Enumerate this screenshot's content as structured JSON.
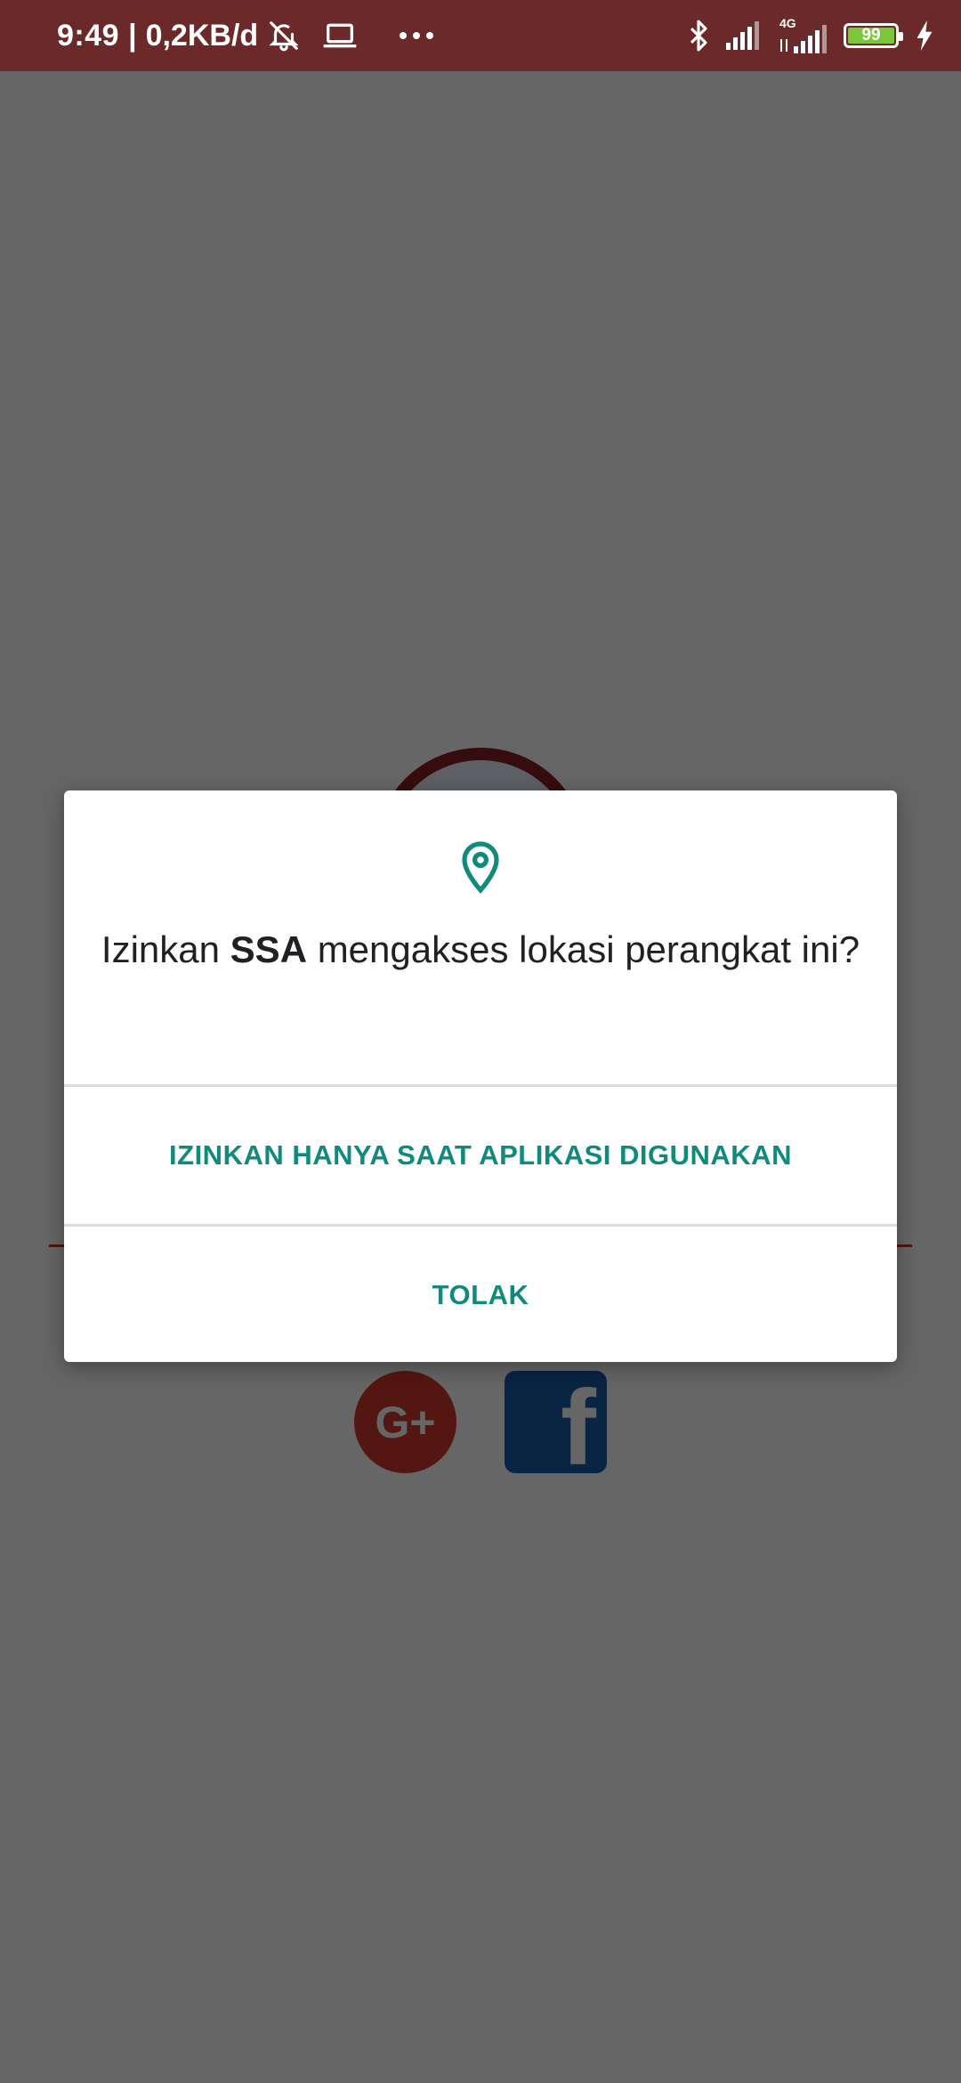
{
  "status_bar": {
    "time": "9:49",
    "separator": "|",
    "net_speed": "0,2KB/d",
    "network_type": "4G",
    "battery_level": "99",
    "icons": [
      "muted-bell-icon",
      "laptop-icon",
      "more-dots-icon",
      "bluetooth-icon",
      "signal-icon",
      "signal-4g-icon",
      "battery-icon",
      "charging-icon"
    ]
  },
  "background_app": {
    "gplus_label": "G+",
    "facebook_label": "f"
  },
  "dialog": {
    "icon": "location-pin-icon",
    "title_prefix": "Izinkan ",
    "title_app": "SSA",
    "title_suffix": " mengakses lokasi perangkat ini?",
    "allow_button": "IZINKAN HANYA SAAT APLIKASI DIGUNAKAN",
    "deny_button": "TOLAK"
  },
  "colors": {
    "status_bar": "#6b2a29",
    "accent": "#0f8a7c",
    "battery_fill": "#7cc63a",
    "scrim": "rgba(0,0,0,0.6)"
  }
}
